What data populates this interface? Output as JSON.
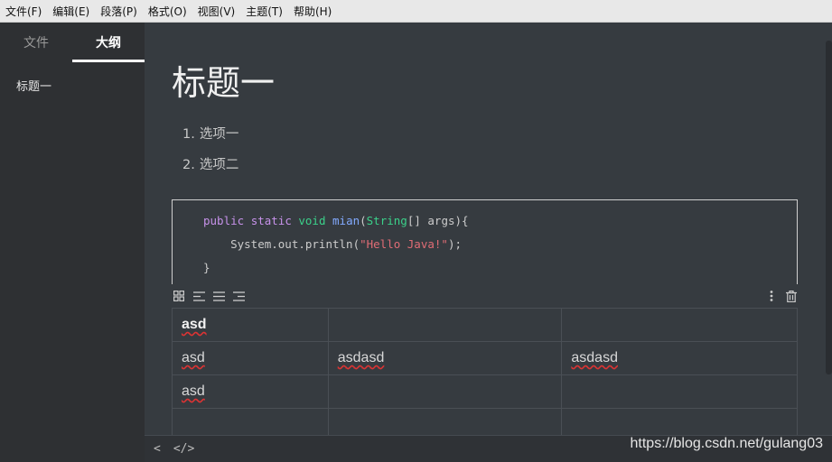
{
  "menu": [
    "文件(F)",
    "编辑(E)",
    "段落(P)",
    "格式(O)",
    "视图(V)",
    "主题(T)",
    "帮助(H)"
  ],
  "sidebar": {
    "tabs": [
      "文件",
      "大纲"
    ],
    "active_tab": "大纲",
    "outline": [
      "标题一"
    ]
  },
  "doc": {
    "heading": "标题一",
    "list": [
      {
        "num": "1.",
        "text": "选项一"
      },
      {
        "num": "2.",
        "text": "选项二"
      }
    ],
    "code": {
      "kw1": "public",
      "kw2": "static",
      "kw3": "void",
      "fn": "mian",
      "open": "(",
      "type": "String",
      "args": "[] args){",
      "line2_pre": "    System.out.println(",
      "line2_str": "\"Hello Java!\"",
      "line2_post": ");",
      "line3": "}"
    },
    "table": {
      "rows": [
        [
          "asd",
          "",
          ""
        ],
        [
          "asd",
          "asdasd",
          "asdasd"
        ],
        [
          "asd",
          "",
          ""
        ],
        [
          "",
          "",
          ""
        ]
      ]
    }
  },
  "statusbar": {
    "left": "<",
    "source": "</>"
  },
  "watermark": "https://blog.csdn.net/gulang03",
  "colors": {
    "keyword": "#c792ea",
    "type": "#3bd18a",
    "function": "#82aaff",
    "string": "#e06c75"
  }
}
